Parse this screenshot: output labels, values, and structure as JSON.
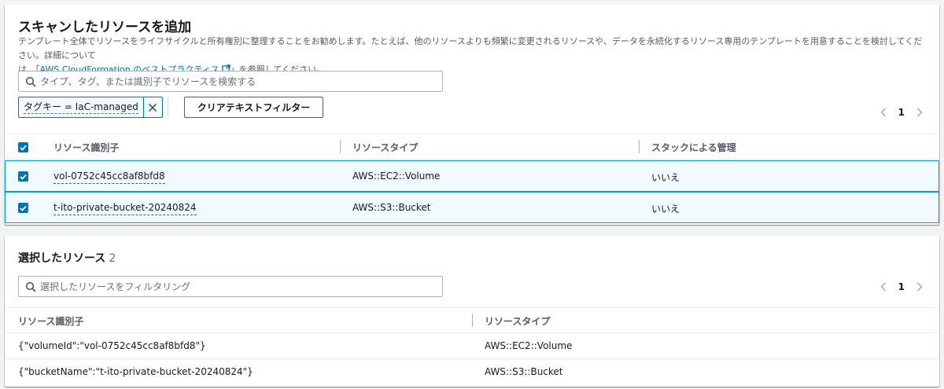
{
  "scan": {
    "title": "スキャンしたリソースを追加",
    "desc_line1": "テンプレート全体でリソースをライフサイクルと所有権別に整理することをお勧めします。たとえば、他のリソースよりも頻繁に変更されるリソースや、データを永続化するリソース専用のテンプレートを用意することを検討してください。詳細について",
    "desc_line2_prefix": "は、「",
    "desc_link": "AWS CloudFormation のベストプラクティス",
    "desc_line2_suffix": "」を参照してください。",
    "search_placeholder": "タイプ、タグ、または識別子でリソースを検索する",
    "filter_token": "タグキー = IaC-managed",
    "clear_button": "クリアテキストフィルター",
    "page": "1",
    "columns": [
      "リソース識別子",
      "リソースタイプ",
      "スタックによる管理"
    ],
    "rows": [
      {
        "id": "vol-0752c45cc8af8bfd8",
        "type": "AWS::EC2::Volume",
        "managed": "いいえ"
      },
      {
        "id": "t-ito-private-bucket-20240824",
        "type": "AWS::S3::Bucket",
        "managed": "いいえ"
      }
    ]
  },
  "selected": {
    "title": "選択したリソース",
    "count": "2",
    "search_placeholder": "選択したリソースをフィルタリング",
    "page": "1",
    "columns": [
      "リソース識別子",
      "リソースタイプ"
    ],
    "rows": [
      {
        "id": "{\"volumeId\":\"vol-0752c45cc8af8bfd8\"}",
        "type": "AWS::EC2::Volume"
      },
      {
        "id": "{\"bucketName\":\"t-ito-private-bucket-20240824\"}",
        "type": "AWS::S3::Bucket"
      }
    ]
  },
  "colors": {
    "accent": "#0073bb",
    "row_selected_bg": "#f1faff",
    "row_selected_border": "#00a1c9"
  }
}
